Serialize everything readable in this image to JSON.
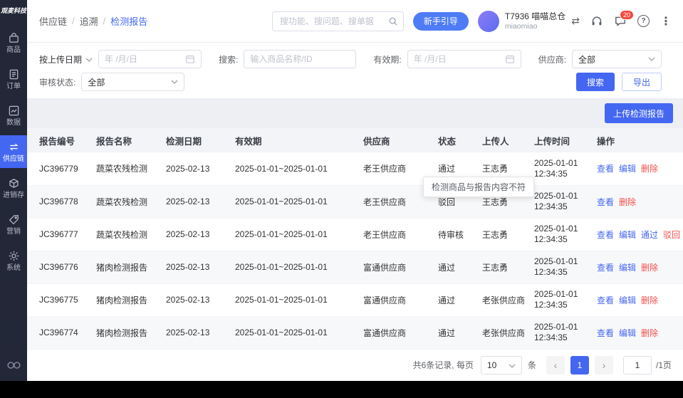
{
  "colors": {
    "primary": "#4467F2",
    "danger": "#F2504B",
    "sidebar": "#232838"
  },
  "icons": {
    "swap": "⇄",
    "help": "?",
    "more": "⋮",
    "prev": "‹",
    "next": "›"
  },
  "sidebar": {
    "logo": "观麦科技",
    "items": [
      {
        "label": "商品"
      },
      {
        "label": "订单"
      },
      {
        "label": "数据"
      },
      {
        "label": "供应链"
      },
      {
        "label": "进销存"
      },
      {
        "label": "营销"
      },
      {
        "label": "系统"
      }
    ]
  },
  "header": {
    "breadcrumb": [
      "供应链",
      "追溯",
      "检测报告"
    ],
    "separator": "/",
    "search_placeholder": "搜功能、搜问题、搜单据",
    "guide_button": "新手引导",
    "user_name": "T7936 喵喵总仓",
    "user_subname": "miaomiao",
    "message_badge": "20"
  },
  "filters": {
    "date_type_label": "按上传日期",
    "upload_date_placeholder": "年 /月/日",
    "search_label": "搜索:",
    "search_placeholder": "输入商品名称/ID",
    "validity_label": "有效期:",
    "validity_placeholder": "年 /月/日",
    "supplier_label": "供应商:",
    "supplier_value": "全部",
    "audit_label": "审核状态:",
    "audit_value": "全部",
    "search_button": "搜索",
    "export_button": "导出"
  },
  "toolbar": {
    "upload_button": "上传检测报告"
  },
  "table": {
    "columns": [
      "报告编号",
      "报告名称",
      "检测日期",
      "有效期",
      "供应商",
      "状态",
      "上传人",
      "上传时间",
      "操作"
    ],
    "tooltip": "检测商品与报告内容不符",
    "rows": [
      {
        "report_no": "JC396779",
        "report_name": "蔬菜农残检测",
        "test_date": "2025-02-13",
        "validity": "2025-01-01~2025-01-01",
        "supplier": "老王供应商",
        "status": "通过",
        "uploader": "王志勇",
        "upload_date": "2025-01-01",
        "upload_time": "12:34:35"
      },
      {
        "report_no": "JC396778",
        "report_name": "蔬菜农残检测",
        "test_date": "2025-02-13",
        "validity": "2025-01-01~2025-01-01",
        "supplier": "老王供应商",
        "status": "驳回",
        "uploader": "王志勇",
        "upload_date": "2025-01-01",
        "upload_time": "12:34:35"
      },
      {
        "report_no": "JC396777",
        "report_name": "蔬菜农残检测",
        "test_date": "2025-02-13",
        "validity": "2025-01-01~2025-01-01",
        "supplier": "老王供应商",
        "status": "待审核",
        "uploader": "王志勇",
        "upload_date": "2025-01-01",
        "upload_time": "12:34:35"
      },
      {
        "report_no": "JC396776",
        "report_name": "猪肉检测报告",
        "test_date": "2025-02-13",
        "validity": "2025-01-01~2025-01-01",
        "supplier": "富通供应商",
        "status": "通过",
        "uploader": "王志勇",
        "upload_date": "2025-01-01",
        "upload_time": "12:34:35"
      },
      {
        "report_no": "JC396775",
        "report_name": "猪肉检测报告",
        "test_date": "2025-02-13",
        "validity": "2025-01-01~2025-01-01",
        "supplier": "富通供应商",
        "status": "通过",
        "uploader": "老张供应商",
        "upload_date": "2025-01-01",
        "upload_time": "12:34:35"
      },
      {
        "report_no": "JC396774",
        "report_name": "猪肉检测报告",
        "test_date": "2025-02-13",
        "validity": "2025-01-01~2025-01-01",
        "supplier": "富通供应商",
        "status": "通过",
        "uploader": "老张供应商",
        "upload_date": "2025-01-01",
        "upload_time": "12:34:35"
      }
    ]
  },
  "actions": {
    "view": "查看",
    "edit": "编辑",
    "delete": "删除",
    "approve": "通过",
    "reject": "驳回"
  },
  "pagination": {
    "summary": "共6条记录, 每页",
    "page_size": "10",
    "unit": "条",
    "current_page": "1",
    "jump_value": "1",
    "total_label": "/1页"
  }
}
